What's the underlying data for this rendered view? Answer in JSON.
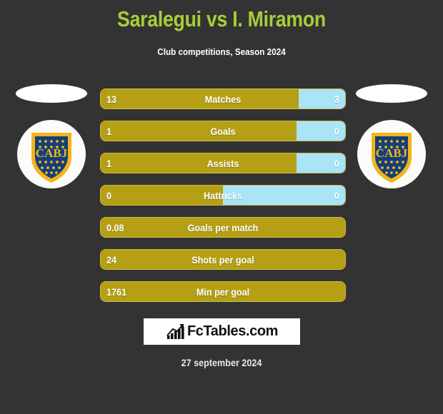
{
  "header": {
    "title": "Saralegui vs I. Miramon",
    "subtitle": "Club competitions, Season 2024"
  },
  "colors": {
    "background": "#333333",
    "title": "#a6ce39",
    "home_bar": "#b59f14",
    "away_bar": "#a9e4f7",
    "bar_border": "#cfbc43",
    "crest_blue": "#12407a",
    "crest_gold": "#f5b31b"
  },
  "teams": {
    "home": {
      "crest_text": "CABJ"
    },
    "away": {
      "crest_text": "CABJ"
    }
  },
  "chart_data": {
    "type": "bar",
    "title": "Saralegui vs I. Miramon",
    "subtitle": "Club competitions, Season 2024",
    "orientation": "horizontal-split",
    "series": [
      {
        "name": "Saralegui",
        "color": "#b59f14"
      },
      {
        "name": "I. Miramon",
        "color": "#a9e4f7"
      }
    ],
    "categories": [
      "Matches",
      "Goals",
      "Assists",
      "Hattricks",
      "Goals per match",
      "Shots per goal",
      "Min per goal"
    ],
    "rows": [
      {
        "label": "Matches",
        "home": "13",
        "away": "3",
        "home_pct": 81,
        "split": true
      },
      {
        "label": "Goals",
        "home": "1",
        "away": "0",
        "home_pct": 80,
        "split": true
      },
      {
        "label": "Assists",
        "home": "1",
        "away": "0",
        "home_pct": 80,
        "split": true
      },
      {
        "label": "Hattricks",
        "home": "0",
        "away": "0",
        "home_pct": 50,
        "split": true
      },
      {
        "label": "Goals per match",
        "home": "0.08",
        "away": "",
        "home_pct": 100,
        "split": false
      },
      {
        "label": "Shots per goal",
        "home": "24",
        "away": "",
        "home_pct": 100,
        "split": false
      },
      {
        "label": "Min per goal",
        "home": "1761",
        "away": "",
        "home_pct": 100,
        "split": false
      }
    ]
  },
  "footer": {
    "logo_text": "FcTables.com",
    "logo_icon": "bar-chart-growth-icon",
    "date": "27 september 2024"
  }
}
